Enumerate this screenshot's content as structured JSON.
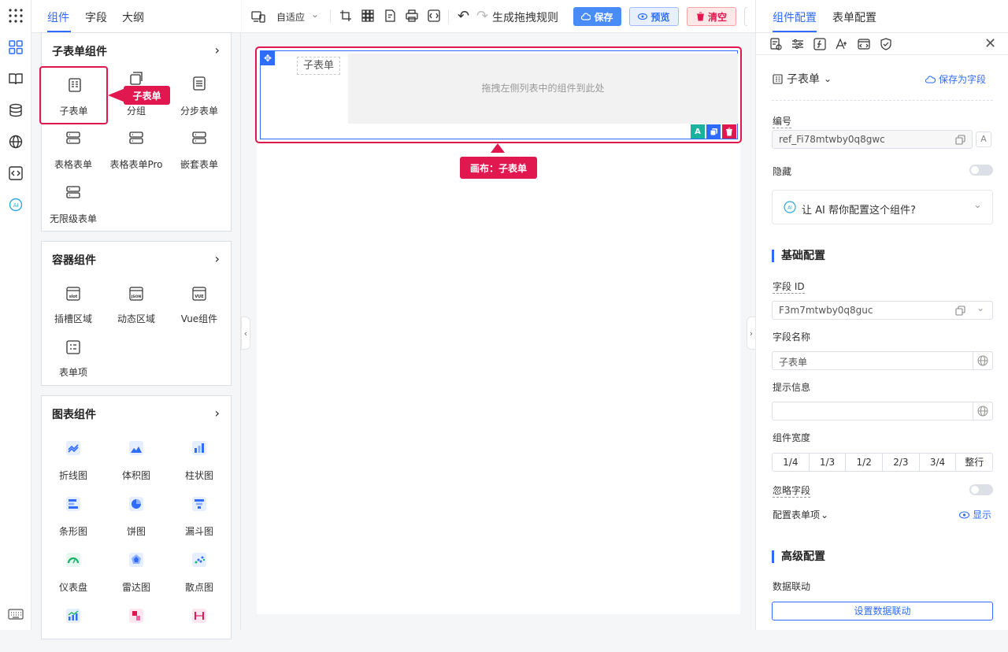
{
  "left_tabs": [
    "组件",
    "字段",
    "大纲"
  ],
  "groups": {
    "subform": {
      "title": "子表单组件",
      "items": [
        "子表单",
        "分组",
        "分步表单",
        "表格表单",
        "表格表单Pro",
        "嵌套表单",
        "无限级表单"
      ]
    },
    "container": {
      "title": "容器组件",
      "items": [
        "插槽区域",
        "动态区域",
        "Vue组件",
        "表单项"
      ],
      "icon_texts": [
        "slot",
        "JSON",
        "VUE"
      ]
    },
    "chart": {
      "title": "图表组件",
      "items": [
        "折线图",
        "体积图",
        "柱状图",
        "条形图",
        "饼图",
        "漏斗图",
        "仪表盘",
        "雷达图",
        "散点图"
      ]
    }
  },
  "tooltip_subform": "子表单",
  "toolbar": {
    "adaptive": "自适应",
    "gen_rule": "生成拖拽规则",
    "save": "保存",
    "preview": "预览",
    "clear": "清空"
  },
  "canvas": {
    "field_label": "子表单",
    "drop_hint": "拖拽左侧列表中的组件到此处",
    "tag": "画布：子表单",
    "ai_icon_text": "A"
  },
  "right": {
    "tabs": [
      "组件配置",
      "表单配置"
    ],
    "component_name": "子表单",
    "save_as_field": "保存为字段",
    "id_label": "编号",
    "id_value": "ref_Fi78mtwby0q8gwc",
    "hide_label": "隐藏",
    "ai_help": "让 AI 帮你配置这个组件?",
    "ai_badge": "AI",
    "basic_section": "基础配置",
    "field_id_label": "字段 ID",
    "field_id_value": "F3m7mtwby0q8guc",
    "field_name_label": "字段名称",
    "field_name_value": "子表单",
    "hint_label": "提示信息",
    "hint_value": "",
    "width_label": "组件宽度",
    "width_options": [
      "1/4",
      "1/3",
      "1/2",
      "2/3",
      "3/4",
      "整行"
    ],
    "ignore_label": "忽略字段",
    "config_items_label": "配置表单项",
    "show_label": "显示",
    "advanced_section": "高级配置",
    "linkage_label": "数据联动",
    "linkage_button": "设置数据联动"
  },
  "colors": {
    "accent": "#2f6bff",
    "highlight": "#e0184f",
    "save_bg": "#4a8cf7",
    "preview_bg": "#e8f0ff",
    "clear_bg": "#fde8e8"
  }
}
